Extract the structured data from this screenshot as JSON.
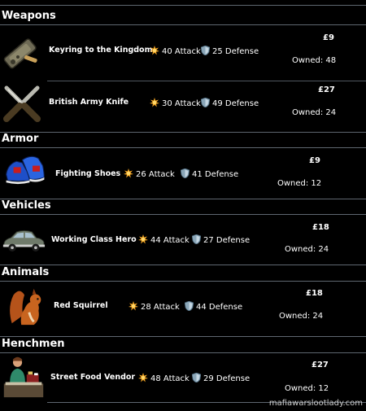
{
  "sections": {
    "weapons": "Weapons",
    "armor": "Armor",
    "vehicles": "Vehicles",
    "animals": "Animals",
    "henchmen": "Henchmen"
  },
  "items": [
    {
      "name": "Keyring to the Kingdom",
      "attack": "40 Attack",
      "defense": "25 Defense",
      "price": "£9",
      "owned": "Owned: 48"
    },
    {
      "name": "British Army Knife",
      "attack": "30 Attack",
      "defense": "49 Defense",
      "price": "£27",
      "owned": "Owned: 24"
    },
    {
      "name": "Fighting Shoes",
      "attack": "26 Attack",
      "defense": "41 Defense",
      "price": "£9",
      "owned": "Owned: 12"
    },
    {
      "name": "Working Class Hero",
      "attack": "44 Attack",
      "defense": "27 Defense",
      "price": "£18",
      "owned": "Owned: 24"
    },
    {
      "name": "Red Squirrel",
      "attack": "28 Attack",
      "defense": "44 Defense",
      "price": "£18",
      "owned": "Owned: 24"
    },
    {
      "name": "Street Food Vendor",
      "attack": "48 Attack",
      "defense": "29 Defense",
      "price": "£27",
      "owned": "Owned: 12"
    }
  ],
  "watermark": "mafiawarslootlady.com",
  "icons": {
    "attack": "attack-burst-icon",
    "defense": "defense-shield-icon"
  },
  "colors": {
    "background": "#000000",
    "divider": "#5f6770",
    "attack_icon": "#f5a623",
    "defense_icon": "#8aa6b8"
  }
}
